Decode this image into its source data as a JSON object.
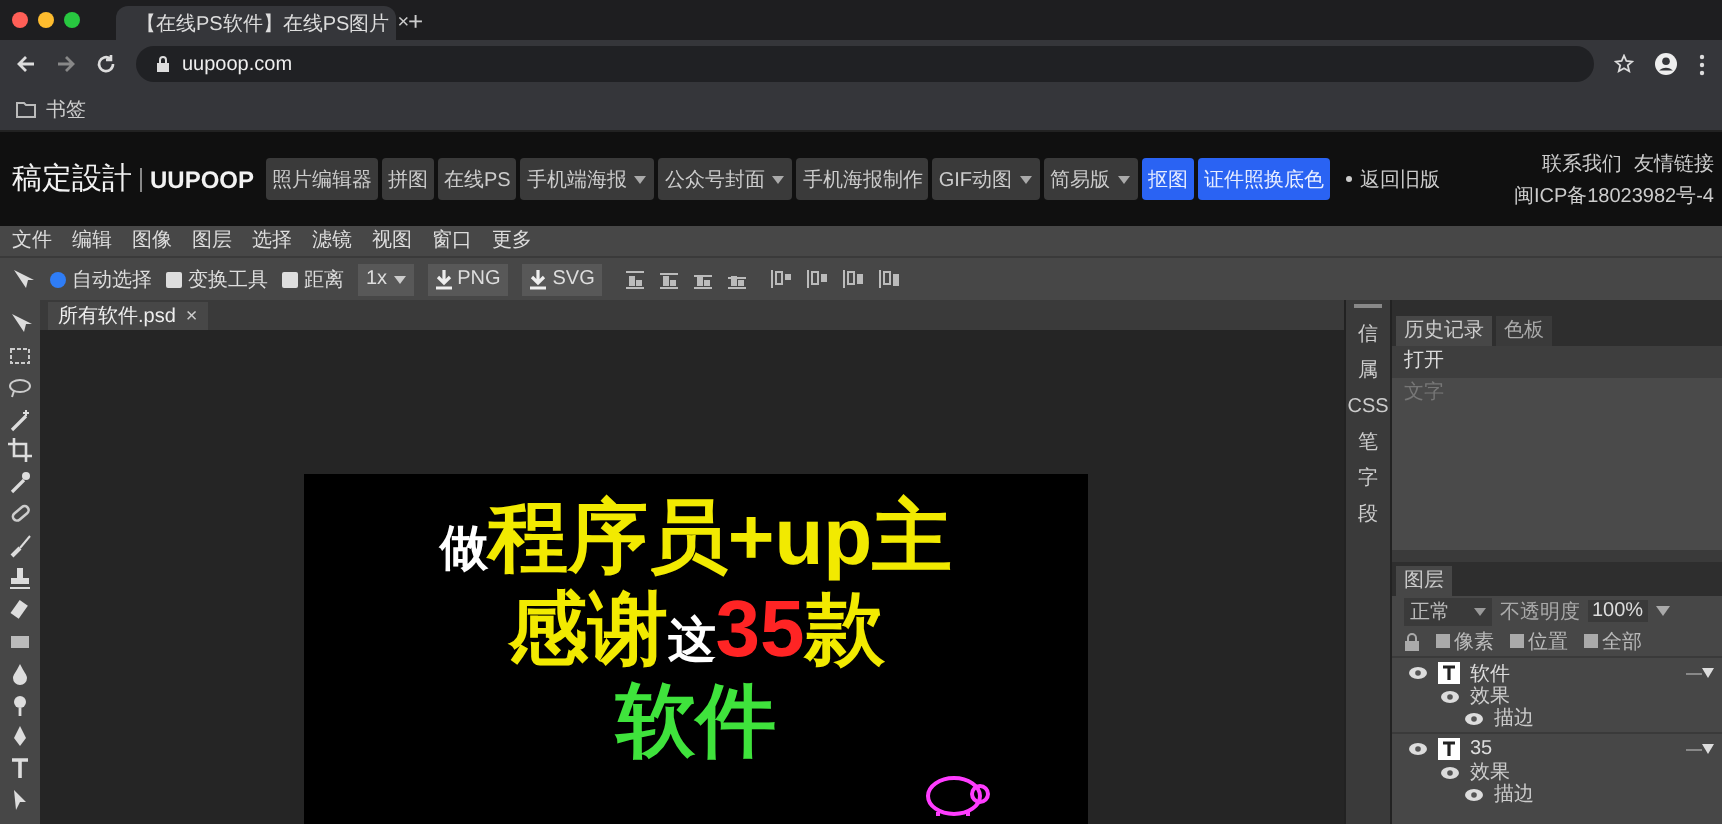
{
  "browser": {
    "tab": {
      "title": "【在线PS软件】在线PS图片",
      "close": "×"
    },
    "new_tab": "+",
    "url": "uupoop.com",
    "bookmarks": [
      {
        "label": "书签"
      }
    ]
  },
  "header": {
    "logo": "稿定設計",
    "brand": "UUPOOP",
    "nav": [
      {
        "label": "照片编辑器",
        "dropdown": false,
        "primary": false
      },
      {
        "label": "拼图",
        "dropdown": false,
        "primary": false
      },
      {
        "label": "在线PS",
        "dropdown": false,
        "primary": false
      },
      {
        "label": "手机端海报",
        "dropdown": true,
        "primary": false
      },
      {
        "label": "公众号封面",
        "dropdown": true,
        "primary": false
      },
      {
        "label": "手机海报制作",
        "dropdown": false,
        "primary": false
      },
      {
        "label": "GIF动图",
        "dropdown": true,
        "primary": false
      },
      {
        "label": "简易版",
        "dropdown": true,
        "primary": false
      },
      {
        "label": "抠图",
        "dropdown": false,
        "primary": true
      },
      {
        "label": "证件照换底色",
        "dropdown": false,
        "primary": true
      }
    ],
    "old_version": "返回旧版",
    "links": [
      "联系我们",
      "友情链接"
    ],
    "icp": "闽ICP备18023982号-4"
  },
  "menu": [
    "文件",
    "编辑",
    "图像",
    "图层",
    "选择",
    "滤镜",
    "视图",
    "窗口",
    "更多"
  ],
  "options": {
    "checks": [
      {
        "label": "自动选择",
        "checked": true
      },
      {
        "label": "变换工具",
        "checked": false
      },
      {
        "label": "距离",
        "checked": false
      }
    ],
    "scale": "1x",
    "exports": [
      "PNG",
      "SVG"
    ]
  },
  "document": {
    "tab": "所有软件.psd",
    "close": "×",
    "lines": [
      [
        {
          "text": "做",
          "color": "#ffffff",
          "kind": "small"
        },
        {
          "text": "程序员+up主",
          "color": "#f2ea00",
          "kind": "large"
        }
      ],
      [
        {
          "text": "感谢",
          "color": "#f2ea00",
          "kind": "large"
        },
        {
          "text": "这",
          "color": "#ffffff",
          "kind": "small"
        },
        {
          "text": "35",
          "color": "#ff2424",
          "kind": "large"
        },
        {
          "text": "款",
          "color": "#f2ea00",
          "kind": "large"
        }
      ],
      [
        {
          "text": "软件",
          "color": "#3fe33c",
          "kind": "large"
        }
      ]
    ]
  },
  "side_icons": [
    "信",
    "属",
    "CSS",
    "笔",
    "字",
    "段"
  ],
  "history_panel": {
    "tabs": [
      {
        "label": "历史记录",
        "selected": true
      },
      {
        "label": "色板",
        "selected": false
      }
    ],
    "items": [
      {
        "label": "打开",
        "disabled": false
      },
      {
        "label": "文字",
        "disabled": true
      }
    ]
  },
  "layers_panel": {
    "tab": "图层",
    "blend": "正常",
    "opacity_label": "不透明度",
    "opacity": "100%",
    "locks": [
      {
        "label": "像素",
        "checked": false
      },
      {
        "label": "位置",
        "checked": false
      },
      {
        "label": "全部",
        "checked": false
      }
    ],
    "layers": [
      {
        "name": "软件",
        "visible": true,
        "children": [
          {
            "name": "效果",
            "visible": true,
            "children": [
              {
                "name": "描边",
                "visible": true
              }
            ]
          }
        ]
      },
      {
        "name": "35",
        "visible": true,
        "children": [
          {
            "name": "效果",
            "visible": true,
            "children": [
              {
                "name": "描边",
                "visible": true
              }
            ]
          }
        ]
      }
    ]
  }
}
